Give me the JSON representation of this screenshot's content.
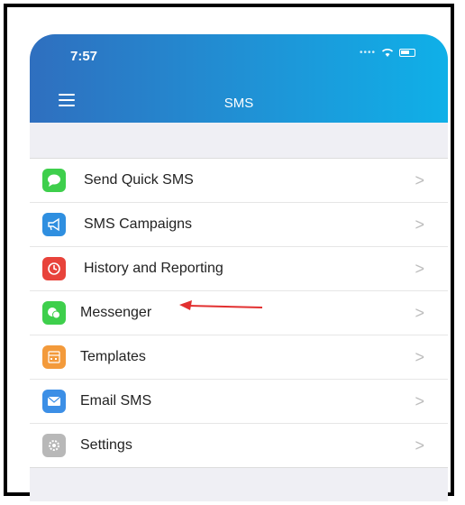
{
  "status_bar": {
    "time": "7:57"
  },
  "header": {
    "title": "SMS"
  },
  "menu": [
    {
      "label": "Send Quick SMS",
      "icon": "chat-bubble-icon",
      "color": "#3ecf4c"
    },
    {
      "label": "SMS Campaigns",
      "icon": "megaphone-icon",
      "color": "#2f8fe0"
    },
    {
      "label": "History and Reporting",
      "icon": "history-clock-icon",
      "color": "#e8433b"
    },
    {
      "label": "Messenger",
      "icon": "messenger-icon",
      "color": "#3ecf4c"
    },
    {
      "label": "Templates",
      "icon": "templates-icon",
      "color": "#f39a3b"
    },
    {
      "label": "Email SMS",
      "icon": "envelope-icon",
      "color": "#3c8fe6"
    },
    {
      "label": "Settings",
      "icon": "gear-icon",
      "color": "#b8b8b8"
    }
  ],
  "chevron": ">",
  "annotation": {
    "arrow_color": "#e23030"
  }
}
